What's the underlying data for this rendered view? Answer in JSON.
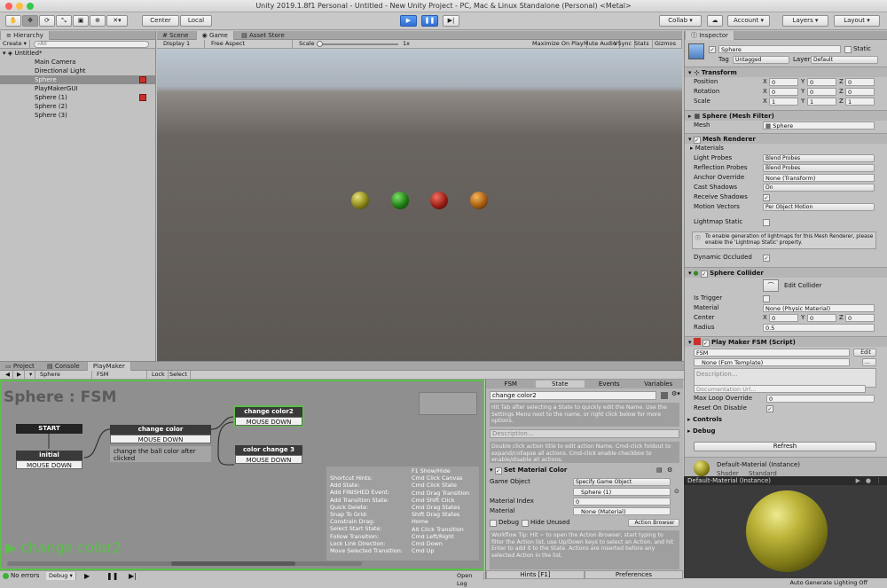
{
  "window": {
    "title": "Unity 2019.1.8f1 Personal - Untitled - New Unity Project - PC, Mac & Linux Standalone (Personal) <Metal>"
  },
  "toolbar": {
    "pivot": "Center",
    "space": "Local",
    "collab": "Collab ▾",
    "account": "Account ▾",
    "layers": "Layers ▾",
    "layout": "Layout ▾"
  },
  "hierarchy": {
    "tab": "Hierarchy",
    "create": "Create ▾",
    "search_placeholder": "⌕All",
    "scene": "Untitled*",
    "items": [
      "Main Camera",
      "Directional Light",
      "Sphere",
      "PlayMakerGUI",
      "Sphere (1)",
      "Sphere (2)",
      "Sphere (3)"
    ]
  },
  "center": {
    "tabs": [
      "Scene",
      "Game",
      "Asset Store"
    ],
    "display": "Display 1",
    "aspect": "Free Aspect",
    "scale_label": "Scale",
    "scale_value": "1x",
    "options": [
      "Maximize On Play",
      "Mute Audio",
      "VSync",
      "Stats",
      "Gizmos ▾"
    ]
  },
  "inspector": {
    "tab": "Inspector",
    "object_name": "Sphere",
    "static": "Static",
    "tag_label": "Tag",
    "tag_value": "Untagged",
    "layer_label": "Layer",
    "layer_value": "Default",
    "transform": {
      "title": "Transform",
      "position": {
        "label": "Position",
        "x": "0",
        "y": "0",
        "z": "0"
      },
      "rotation": {
        "label": "Rotation",
        "x": "0",
        "y": "0",
        "z": "0"
      },
      "scale": {
        "label": "Scale",
        "x": "1",
        "y": "1",
        "z": "1"
      }
    },
    "mesh_filter": {
      "title": "Sphere (Mesh Filter)",
      "mesh_label": "Mesh",
      "mesh_value": "Sphere"
    },
    "mesh_renderer": {
      "title": "Mesh Renderer",
      "materials": "Materials",
      "rows": [
        {
          "label": "Light Probes",
          "value": "Blend Probes"
        },
        {
          "label": "Reflection Probes",
          "value": "Blend Probes"
        },
        {
          "label": "Anchor Override",
          "value": "None (Transform)"
        },
        {
          "label": "Cast Shadows",
          "value": "On"
        },
        {
          "label": "Receive Shadows",
          "value": "✓"
        },
        {
          "label": "Motion Vectors",
          "value": "Per Object Motion"
        }
      ],
      "lightmap_static": "Lightmap Static",
      "info": "To enable generation of lightmaps for this Mesh Renderer, please enable the 'Lightmap Static' property.",
      "dynamic_occluded": "Dynamic Occluded"
    },
    "collider": {
      "title": "Sphere Collider",
      "edit": "Edit Collider",
      "is_trigger": "Is Trigger",
      "material_label": "Material",
      "material_value": "None (Physic Material)",
      "center_label": "Center",
      "cx": "0",
      "cy": "0",
      "cz": "0",
      "radius_label": "Radius",
      "radius_value": "0.5"
    },
    "fsm": {
      "title": "Play Maker FSM (Script)",
      "name": "FSM",
      "edit": "Edit",
      "template": "None (Fsm Template)",
      "description_placeholder": "Description...",
      "doc_placeholder": "Documentation Url...",
      "max_loop_label": "Max Loop Override",
      "max_loop_value": "0",
      "reset_label": "Reset On Disable",
      "controls": "Controls",
      "debug": "Debug",
      "refresh": "Refresh"
    },
    "material": {
      "title": "Default-Material (Instance)",
      "shader_label": "Shader",
      "shader_value": "Standard"
    }
  },
  "preview": {
    "title": "Default-Material (Instance)",
    "status": "Auto Generate Lighting Off"
  },
  "bottom": {
    "tabs": [
      "Project",
      "Console",
      "PlayMaker"
    ],
    "object": "Sphere",
    "fsm": "FSM",
    "lock": "Lock",
    "select": "Select",
    "graph_title": "Sphere : FSM",
    "states": {
      "start": "START",
      "initial": "initial",
      "initial_event": "MOUSE DOWN",
      "cc": "change color",
      "cc_event": "MOUSE DOWN",
      "cc_comment": "change the ball color after clicked",
      "cc2": "change color2",
      "cc2_event": "MOUSE DOWN",
      "cc3": "color change 3",
      "cc3_event": "MOUSE DOWN"
    },
    "current_state": "change color2",
    "hints_left": [
      "Shortcut Hints:",
      "Add State:",
      "Add FINISHED Event:",
      "Add Transition State:",
      "Quick Delete:",
      "Snap To Grid:",
      "Constrain Drag:",
      "Select Start State:",
      "Follow Transition:",
      "Lock Link Direction:",
      "Move Selected Transition:"
    ],
    "hints_right": [
      "F1 Show/Hide",
      "Cmd Click Canvas",
      "Cmd Click State",
      "Cmd Drag Transition",
      "Cmd Shift Click",
      "Cmd Drag States",
      "Shift Drag States",
      "Home",
      "Alt Click Transition",
      "Cmd Left/Right",
      "Cmd Down",
      "Cmd Up"
    ],
    "status": {
      "errors": "No errors",
      "debug": "Debug ▾",
      "openlog": "Open Log"
    }
  },
  "fsm_panel": {
    "tabs": [
      "FSM",
      "State",
      "Events",
      "Variables"
    ],
    "state_name": "change color2",
    "hint1": "Hit Tab after selecting a State to quickly edit the Name. Use the Settings Menu next to the name, or right click below for more options.",
    "description": "Description...",
    "hint2": "Double click action title to edit action Name. Cmd-click foldout to expand/collapse all actions. Cmd-click enable checkbox to enable/disable all actions.",
    "action_title": "Set Material Color",
    "game_object_label": "Game Object",
    "game_object_value": "Specify Game Object",
    "game_object_ref": "Sphere (1)",
    "material_index_label": "Material Index",
    "material_index_value": "0",
    "material_label": "Material",
    "material_value": "None (Material)",
    "debug": "Debug",
    "hide_unused": "Hide Unused",
    "action_browser": "Action Browser",
    "workflow": "Workflow Tip: Hit ~ to open the Action Browser, start typing to filter the Action list, use Up/Down keys to select an Action, and hit Enter to add it to the State. Actions are inserted before any selected Action in the list.",
    "hints_btn": "Hints [F1]",
    "prefs_btn": "Preferences"
  }
}
